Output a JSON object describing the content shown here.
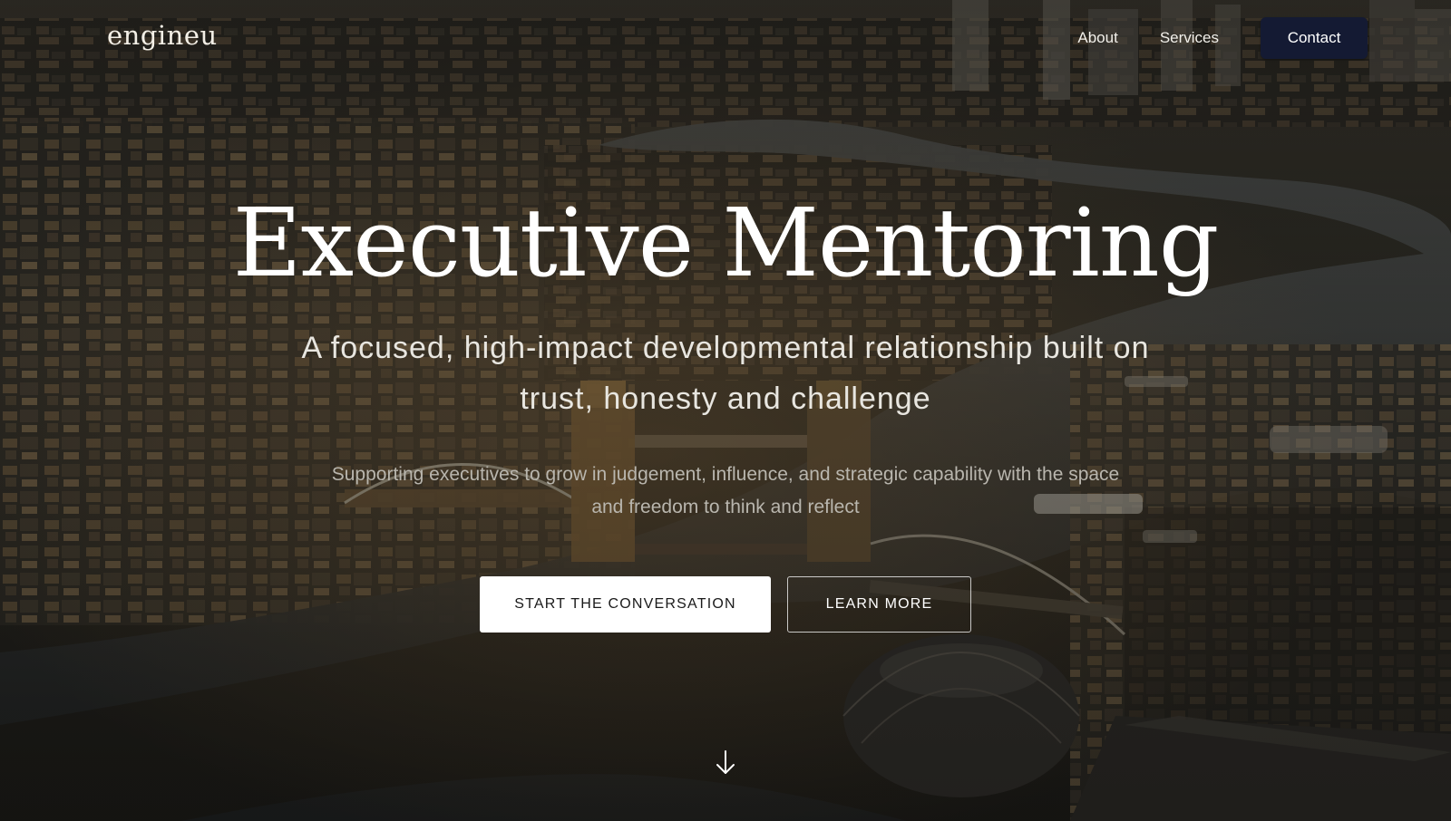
{
  "brand": {
    "logo": "engineu"
  },
  "nav": {
    "about_label": "About",
    "services_label": "Services",
    "contact_label": "Contact"
  },
  "hero": {
    "title": "Executive Mentoring",
    "subtitle": "A focused, high-impact developmental relationship built on trust, honesty and challenge",
    "description": "Supporting executives to grow in judgement, influence, and strategic capability with the space and freedom to think and reflect",
    "primary_cta": "START THE CONVERSATION",
    "secondary_cta": "LEARN MORE"
  },
  "icons": {
    "scroll": "arrow-down-icon"
  },
  "colors": {
    "contact_button_bg": "#141a33",
    "primary_button_bg": "#ffffff",
    "text_light": "#ffffff"
  }
}
